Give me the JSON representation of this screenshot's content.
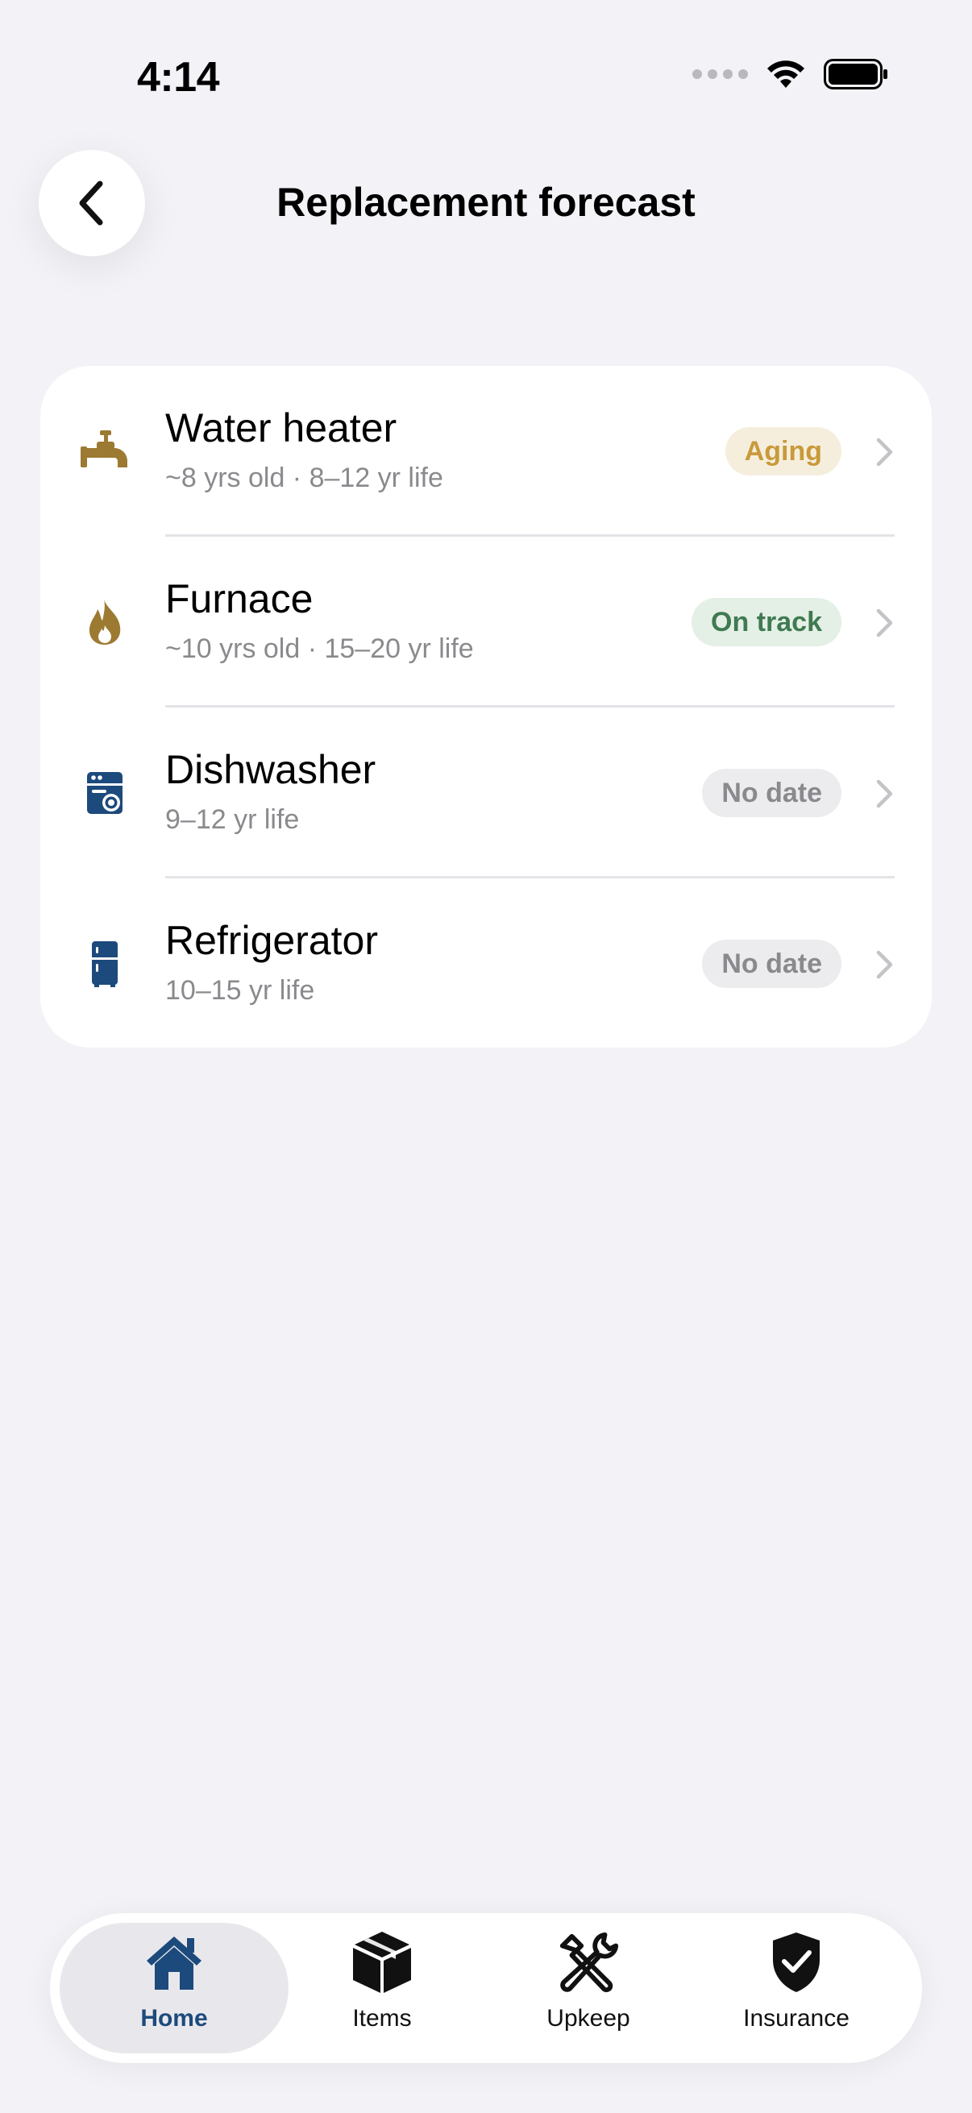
{
  "status_bar": {
    "time": "4:14"
  },
  "header": {
    "title": "Replacement forecast",
    "back_icon": "chevron-left-icon"
  },
  "items": [
    {
      "name": "Water heater",
      "subtitle": "~8 yrs old · 8–12 yr life",
      "status": "Aging",
      "icon": "faucet-icon",
      "icon_color": "#9c7a32"
    },
    {
      "name": "Furnace",
      "subtitle": "~10 yrs old · 15–20 yr life",
      "status": "On track",
      "icon": "flame-icon",
      "icon_color": "#9c7a32"
    },
    {
      "name": "Dishwasher",
      "subtitle": "9–12 yr life",
      "status": "No date",
      "icon": "dishwasher-icon",
      "icon_color": "#1d4a7c"
    },
    {
      "name": "Refrigerator",
      "subtitle": "10–15 yr life",
      "status": "No date",
      "icon": "refrigerator-icon",
      "icon_color": "#1d4a7c"
    }
  ],
  "status_colors": {
    "aging": "#c89a3a",
    "on_track": "#3f7a51",
    "no_date": "#8a8a8e"
  },
  "tab_bar": {
    "tabs": [
      {
        "label": "Home",
        "icon": "house-icon",
        "active": true
      },
      {
        "label": "Items",
        "icon": "box-icon",
        "active": false
      },
      {
        "label": "Upkeep",
        "icon": "tools-icon",
        "active": false
      },
      {
        "label": "Insurance",
        "icon": "shield-check-icon",
        "active": false
      }
    ]
  }
}
